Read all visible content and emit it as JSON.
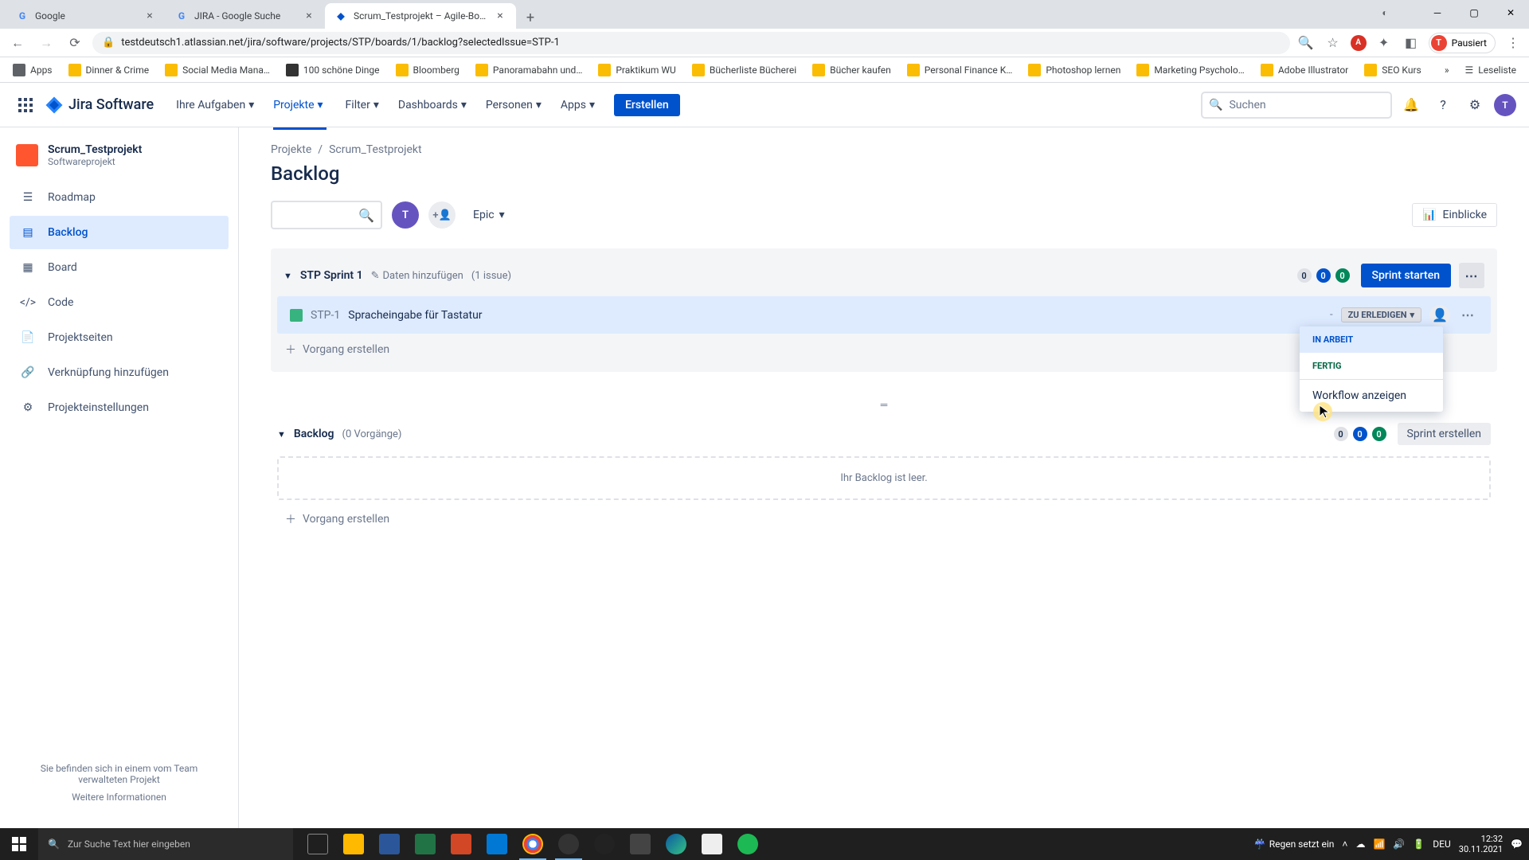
{
  "browser": {
    "tabs": [
      {
        "title": "Google",
        "favicon": "G"
      },
      {
        "title": "JIRA - Google Suche",
        "favicon": "G"
      },
      {
        "title": "Scrum_Testprojekt – Agile-Board",
        "favicon": "J"
      }
    ],
    "url": "testdeutsch1.atlassian.net/jira/software/projects/STP/boards/1/backlog?selectedIssue=STP-1",
    "profile_label": "Pausiert",
    "bookmarks": [
      "Apps",
      "Dinner & Crime",
      "Social Media Mana…",
      "100 schöne Dinge",
      "Bloomberg",
      "Panoramabahn und…",
      "Praktikum WU",
      "Bücherliste Bücherei",
      "Bücher kaufen",
      "Personal Finance K…",
      "Photoshop lernen",
      "Marketing Psycholo…",
      "Adobe Illustrator",
      "SEO Kurs"
    ],
    "reading_list": "Leseliste"
  },
  "jira_nav": {
    "logo": "Jira Software",
    "items": [
      "Ihre Aufgaben",
      "Projekte",
      "Filter",
      "Dashboards",
      "Personen",
      "Apps"
    ],
    "create": "Erstellen",
    "search_placeholder": "Suchen"
  },
  "sidebar": {
    "project_name": "Scrum_Testprojekt",
    "project_type": "Softwareprojekt",
    "items": [
      {
        "label": "Roadmap"
      },
      {
        "label": "Backlog"
      },
      {
        "label": "Board"
      },
      {
        "label": "Code"
      },
      {
        "label": "Projektseiten"
      },
      {
        "label": "Verknüpfung hinzufügen"
      },
      {
        "label": "Projekteinstellungen"
      }
    ],
    "footer_text": "Sie befinden sich in einem vom Team verwalteten Projekt",
    "footer_link": "Weitere Informationen"
  },
  "breadcrumb": {
    "a": "Projekte",
    "sep": "/",
    "b": "Scrum_Testprojekt"
  },
  "page_title": "Backlog",
  "toolbar": {
    "epic": "Epic",
    "insights": "Einblicke",
    "avatar_letter": "T"
  },
  "sprint": {
    "name": "STP Sprint 1",
    "add_dates": "Daten hinzufügen",
    "issue_count": "(1 issue)",
    "badges": {
      "gray": "0",
      "blue": "0",
      "green": "0"
    },
    "start": "Sprint starten",
    "issue": {
      "key": "STP-1",
      "summary": "Spracheingabe für Tastatur",
      "estimate": "-",
      "status": "ZU ERLEDIGEN"
    },
    "create_issue": "Vorgang erstellen"
  },
  "status_dropdown": {
    "in_progress": "IN ARBEIT",
    "done": "FERTIG",
    "workflow": "Workflow anzeigen"
  },
  "backlog": {
    "title": "Backlog",
    "count": "(0 Vorgänge)",
    "badges": {
      "gray": "0",
      "blue": "0",
      "green": "0"
    },
    "create_sprint": "Sprint erstellen",
    "empty": "Ihr Backlog ist leer.",
    "create_issue": "Vorgang erstellen"
  },
  "taskbar": {
    "search": "Zur Suche Text hier eingeben",
    "weather": "Regen setzt ein",
    "lang": "DEU",
    "time": "12:32",
    "date": "30.11.2021"
  }
}
